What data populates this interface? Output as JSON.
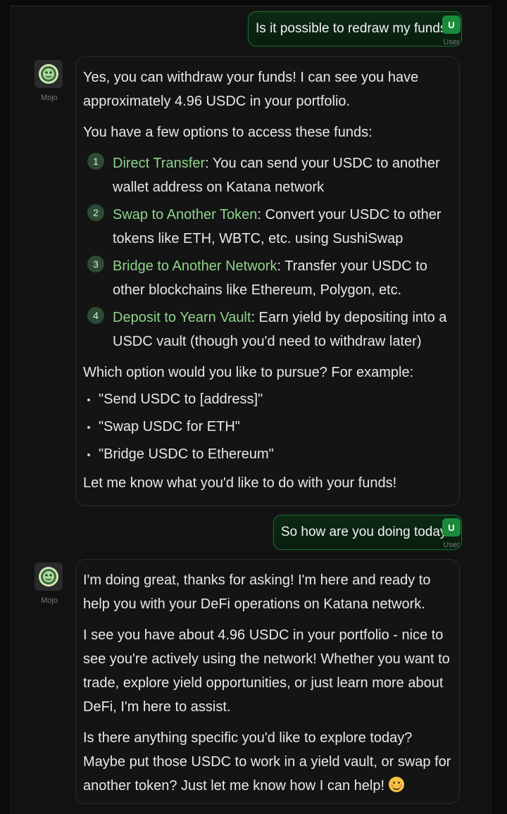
{
  "messages": {
    "user1": {
      "text": "Is it possible to redraw my funds?",
      "avatar": "U",
      "name": "User"
    },
    "bot1": {
      "name": "Mojo",
      "intro": "Yes, you can withdraw your funds! I can see you have approximately 4.96 USDC in your portfolio.",
      "options_lead": "You have a few options to access these funds:",
      "steps": [
        {
          "num": "1",
          "title": "Direct Transfer",
          "text": ": You can send your USDC to another wallet address on Katana network"
        },
        {
          "num": "2",
          "title": "Swap to Another Token",
          "text": ": Convert your USDC to other tokens like ETH, WBTC, etc. using SushiSwap"
        },
        {
          "num": "3",
          "title": "Bridge to Another Network",
          "text": ": Transfer your USDC to other blockchains like Ethereum, Polygon, etc."
        },
        {
          "num": "4",
          "title": "Deposit to Yearn Vault",
          "text": ": Earn yield by depositing into a USDC vault (though you'd need to withdraw later)"
        }
      ],
      "question": "Which option would you like to pursue? For example:",
      "examples": [
        "\"Send USDC to [address]\"",
        "\"Swap USDC for ETH\"",
        "\"Bridge USDC to Ethereum\""
      ],
      "closing": "Let me know what you'd like to do with your funds!"
    },
    "user2": {
      "text": "So how are you doing today?",
      "avatar": "U",
      "name": "User"
    },
    "bot2": {
      "name": "Mojo",
      "p1": "I'm doing great, thanks for asking! I'm here and ready to help you with your DeFi operations on Katana network.",
      "p2": "I see you have about 4.96 USDC in your portfolio - nice to see you're actively using the network! Whether you want to trade, explore yield opportunities, or just learn more about DeFi, I'm here to assist.",
      "p3": "Is there anything specific you'd like to explore today? Maybe put those USDC to work in a yield vault, or swap for another token? Just let me know how I can help!",
      "emoji": "smiling-face-icon"
    }
  },
  "colors": {
    "accent_green": "#8fd38a",
    "user_bubble_border": "#1e6b35",
    "user_avatar": "#1b8a3a"
  }
}
